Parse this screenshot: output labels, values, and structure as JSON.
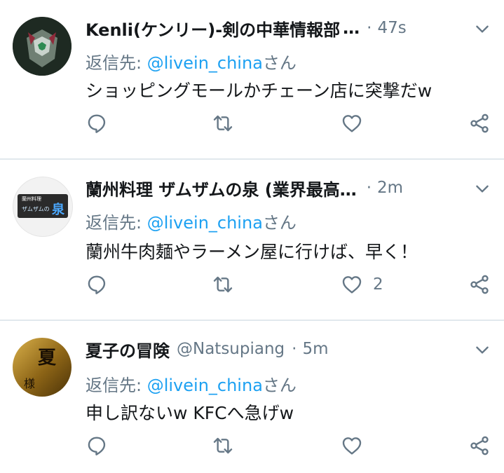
{
  "tweets": [
    {
      "name": "Kenli(ケンリー)-剣の中華情報部",
      "handle": "",
      "ellipsis": "…",
      "time": "47s",
      "reply_prefix": "返信先: ",
      "reply_mention": "@livein_china",
      "reply_suffix": "さん",
      "text": "ショッピングモールかチェーン店に突撃だw",
      "likes": ""
    },
    {
      "name": "蘭州料理 ザムザムの泉 (業界最高…",
      "handle": "",
      "ellipsis": "",
      "time": "2m",
      "reply_prefix": "返信先: ",
      "reply_mention": "@livein_china",
      "reply_suffix": "さん",
      "text": "蘭州牛肉麺やラーメン屋に行けば、早く！",
      "likes": "2"
    },
    {
      "name": "夏子の冒険",
      "handle": "@Natsupiang",
      "ellipsis": "",
      "time": "5m",
      "reply_prefix": "返信先: ",
      "reply_mention": "@livein_china",
      "reply_suffix": "さん",
      "text": "申し訳ないw KFCへ急げw",
      "likes": ""
    }
  ],
  "avatar_2": {
    "line1": "蘭州料理",
    "line2": "ザムザムの",
    "big": "泉"
  },
  "avatar_3": {
    "char1": "夏",
    "char2": "様"
  },
  "icons": {
    "reply": "reply-icon",
    "retweet": "retweet-icon",
    "like": "heart-icon",
    "share": "share-icon",
    "menu": "chevron-down-icon"
  },
  "colors": {
    "link": "#1da1f2",
    "secondary": "#657786",
    "text": "#14171a",
    "divider": "#e1e8ed"
  }
}
